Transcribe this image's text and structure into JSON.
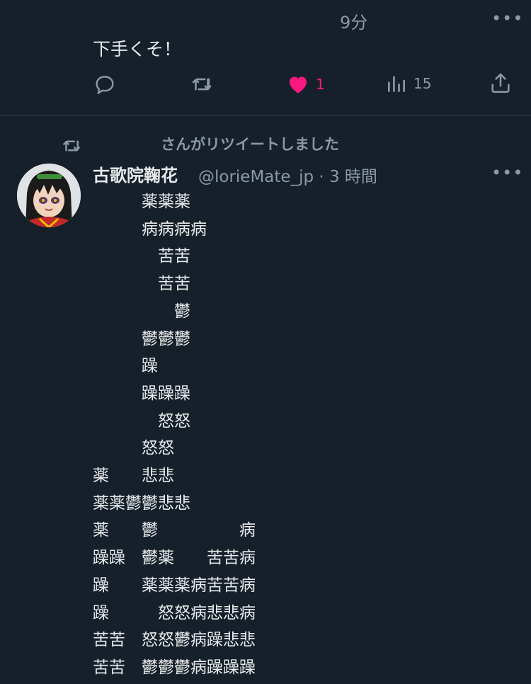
{
  "tweet1": {
    "time": "9分",
    "text": "下手くそ！",
    "more": "•••",
    "actions": {
      "reply": {
        "icon": "reply-icon"
      },
      "retweet": {
        "icon": "retweet-icon"
      },
      "like": {
        "icon": "heart-icon",
        "count": "1",
        "liked": true,
        "color": "#f91880"
      },
      "views": {
        "icon": "views-icon",
        "count": "15"
      },
      "share": {
        "icon": "share-icon"
      }
    }
  },
  "retweet_header": {
    "label": "さんがリツイートしました",
    "icon": "retweet-icon"
  },
  "tweet2": {
    "name": "古歌院鞠花",
    "handle": "@lorieMate_jp · 3 時間",
    "more": "•••",
    "lines": [
      "　　　薬薬薬",
      "　　　病病病病",
      "　　　　苦苦",
      "　　　　苦苦",
      "　　　　　鬱",
      "　　　鬱鬱鬱",
      "　　　躁",
      "　　　躁躁躁",
      "　　　　怒怒",
      "　　　怒怒",
      "薬　　悲悲",
      "薬薬鬱鬱悲悲",
      "薬　　鬱　　　　　病",
      "躁躁　鬱薬　　苦苦病",
      "躁　　薬薬薬病苦苦病",
      "躁　　　怒怒病悲悲病",
      "苦苦　怒怒鬱病躁悲悲",
      "苦苦　鬱鬱鬱病躁躁躁"
    ]
  },
  "colors": {
    "background": "#15202b",
    "text": "#e7e9ea",
    "muted": "#8b98a5",
    "like": "#f91880",
    "divider": "#38444d"
  }
}
